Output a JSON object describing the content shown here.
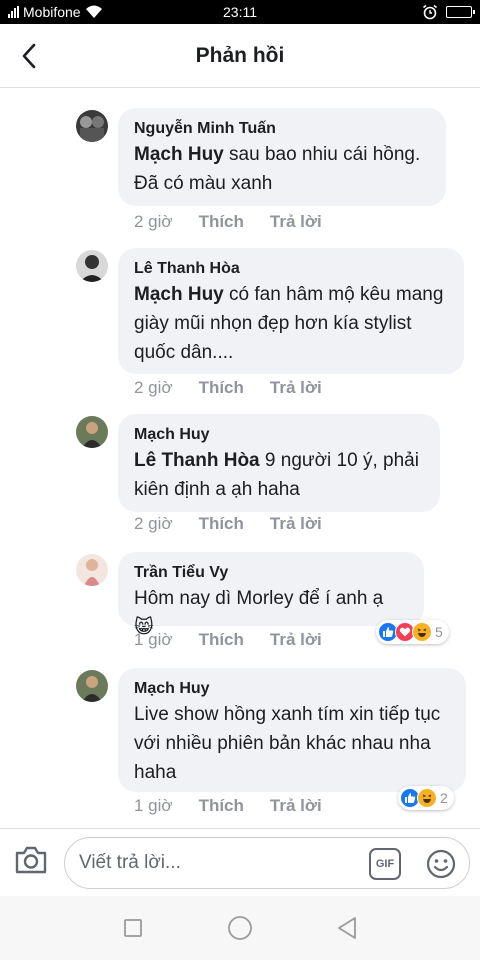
{
  "status_bar": {
    "carrier": "Mobifone",
    "time": "23:11"
  },
  "header": {
    "title": "Phản hồi"
  },
  "comments": [
    {
      "author": "Nguyễn Minh Tuấn",
      "mention": "Mạch Huy",
      "text": " sau bao nhiu cái hồng. Đã có màu xanh",
      "time": "2 giờ",
      "like": "Thích",
      "reply": "Trả lời"
    },
    {
      "author": "Lê Thanh Hòa",
      "mention": "Mạch Huy",
      "text": " có fan hâm mộ kêu mang giày mũi nhọn đẹp hơn kía stylist quốc dân....",
      "time": "2 giờ",
      "like": "Thích",
      "reply": "Trả lời"
    },
    {
      "author": "Mạch Huy",
      "mention": "Lê Thanh Hòa",
      "text": " 9 người 10 ý, phải kiên định a ạh haha",
      "time": "2 giờ",
      "like": "Thích",
      "reply": "Trả lời"
    },
    {
      "author": "Trần Tiểu Vy",
      "mention": "",
      "text": "Hôm nay dì Morley để í anh ạ 😸",
      "time": "1 giờ",
      "like": "Thích",
      "reply": "Trả lời",
      "reactions": {
        "icons": [
          "like",
          "love",
          "haha"
        ],
        "count": "5"
      }
    },
    {
      "author": "Mạch Huy",
      "mention": "",
      "text": "Live show hồng xanh tím xin tiếp tục với nhiều phiên bản khác nhau nha haha",
      "time": "1 giờ",
      "like": "Thích",
      "reply": "Trả lời",
      "reactions": {
        "icons": [
          "like",
          "haha"
        ],
        "count": "2"
      }
    }
  ],
  "composer": {
    "placeholder": "Viết trả lời...",
    "gif_label": "GIF"
  },
  "colors": {
    "bubble": "#f0f2f5",
    "meta_text": "#90949c",
    "like_blue": "#1877f2",
    "love_red": "#f33e58",
    "haha_yellow": "#f7b125"
  }
}
